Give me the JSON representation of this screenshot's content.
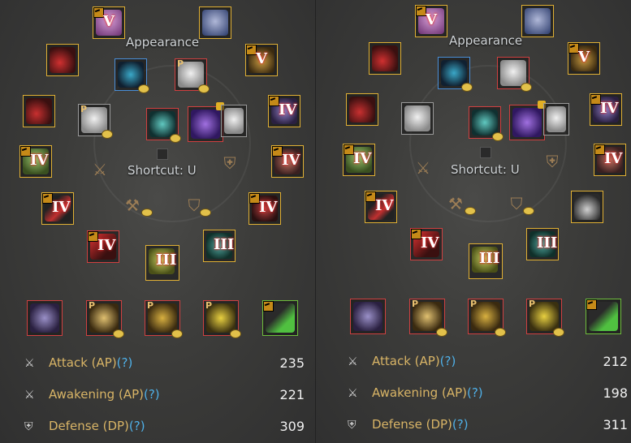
{
  "colors": {
    "gold_border": "#e0b034",
    "red_border": "#d04040",
    "blue_border": "#4a8fd8",
    "green_border": "#6ebd3c",
    "stat_label": "#d8b466",
    "help_mark": "#4fb0e8"
  },
  "panels": [
    {
      "appearance_label": "Appearance",
      "shortcut_label": "Shortcut: U",
      "slots": [
        {
          "name": "helmet-slot",
          "icon": "helmet-icon",
          "enh": "V",
          "p": "",
          "border": "gold"
        },
        {
          "name": "costume-helmet-slot",
          "icon": "helmet-icon",
          "enh": "",
          "p": "",
          "border": "gold"
        },
        {
          "name": "necklace-slot",
          "icon": "necklace-icon",
          "enh": "",
          "p": "",
          "border": "gold"
        },
        {
          "name": "ring-slot",
          "icon": "ring-icon",
          "enh": "V",
          "p": "",
          "border": "gold"
        },
        {
          "name": "main-weapon-slot",
          "icon": "weapon-icon",
          "enh": "IV",
          "p": "",
          "border": "gold"
        },
        {
          "name": "earring-slot",
          "icon": "earring-icon",
          "enh": "IV",
          "p": "",
          "border": "gold"
        },
        {
          "name": "sub-weapon-slot",
          "icon": "weapon-icon",
          "enh": "IV",
          "p": "",
          "border": "gold"
        },
        {
          "name": "gloves-slot",
          "icon": "gloves-icon",
          "enh": "IV",
          "p": "",
          "border": "gold"
        },
        {
          "name": "awakening-weapon-slot",
          "icon": "weapon-icon",
          "enh": "IV",
          "p": "",
          "border": "red"
        },
        {
          "name": "belt-slot",
          "icon": "belt-icon",
          "enh": "III",
          "p": "",
          "border": "gold"
        },
        {
          "name": "alchemy-stone-slot",
          "icon": "stone-icon",
          "enh": "III",
          "p": "",
          "border": "gold"
        }
      ],
      "stats": [
        {
          "label": "Attack (AP)",
          "help": "(?)",
          "value": "235"
        },
        {
          "label": "Awakening (AP)",
          "help": "(?)",
          "value": "221"
        },
        {
          "label": "Defense (DP)",
          "help": "(?)",
          "value": "309"
        }
      ]
    },
    {
      "appearance_label": "Appearance",
      "shortcut_label": "Shortcut: U",
      "slots": [
        {
          "name": "helmet-slot",
          "icon": "helmet-icon",
          "enh": "V",
          "p": "",
          "border": "gold"
        },
        {
          "name": "costume-helmet-slot",
          "icon": "helmet-icon",
          "enh": "",
          "p": "",
          "border": "gold"
        },
        {
          "name": "necklace-slot",
          "icon": "necklace-icon",
          "enh": "",
          "p": "",
          "border": "gold"
        },
        {
          "name": "ring-slot",
          "icon": "ring-icon",
          "enh": "V",
          "p": "",
          "border": "gold"
        },
        {
          "name": "main-weapon-slot",
          "icon": "weapon-icon",
          "enh": "IV",
          "p": "",
          "border": "gold"
        },
        {
          "name": "earring-slot",
          "icon": "earring-icon",
          "enh": "IV",
          "p": "",
          "border": "gold"
        },
        {
          "name": "sub-weapon-slot",
          "icon": "weapon-icon",
          "enh": "IV",
          "p": "",
          "border": "gold"
        },
        {
          "name": "gloves-slot",
          "icon": "gloves-icon",
          "enh": "IV",
          "p": "",
          "border": "gold"
        },
        {
          "name": "awakening-weapon-slot",
          "icon": "weapon-icon",
          "enh": "",
          "p": "",
          "border": "red"
        },
        {
          "name": "belt-slot",
          "icon": "belt-icon",
          "enh": "",
          "p": "",
          "border": "gold"
        },
        {
          "name": "alchemy-stone-slot",
          "icon": "stone-icon",
          "enh": "III",
          "p": "",
          "border": "gold"
        }
      ],
      "stats": [
        {
          "label": "Attack (AP)",
          "help": "(?)",
          "value": "212"
        },
        {
          "label": "Awakening (AP)",
          "help": "(?)",
          "value": "198"
        },
        {
          "label": "Defense (DP)",
          "help": "(?)",
          "value": "311"
        }
      ]
    }
  ],
  "p_marker": "P"
}
